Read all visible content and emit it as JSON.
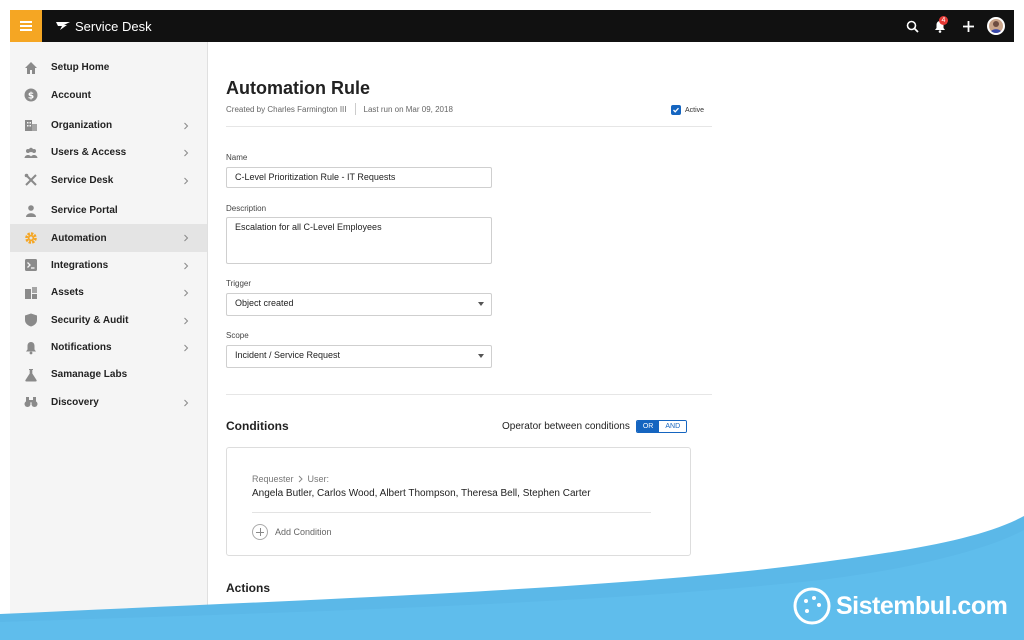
{
  "header": {
    "menu_icon": "hamburger-icon",
    "brand": "Service Desk",
    "icons": [
      "search-icon",
      "bell-icon",
      "plus-icon",
      "avatar"
    ],
    "notification_count": "4",
    "accent_color": "#f5a623"
  },
  "sidebar": {
    "items": [
      {
        "label": "Setup Home",
        "icon": "home-icon",
        "chevron": false
      },
      {
        "label": "Account",
        "icon": "dollar-icon",
        "chevron": false
      },
      {
        "label": "Organization",
        "icon": "building-icon",
        "chevron": true
      },
      {
        "label": "Users & Access",
        "icon": "users-icon",
        "chevron": true
      },
      {
        "label": "Service Desk",
        "icon": "tools-icon",
        "chevron": true
      },
      {
        "label": "Service Portal",
        "icon": "person-icon",
        "chevron": false
      },
      {
        "label": "Automation",
        "icon": "gear-icon",
        "chevron": true,
        "active": true
      },
      {
        "label": "Integrations",
        "icon": "terminal-icon",
        "chevron": true
      },
      {
        "label": "Assets",
        "icon": "assets-icon",
        "chevron": true
      },
      {
        "label": "Security & Audit",
        "icon": "shield-icon",
        "chevron": true
      },
      {
        "label": "Notifications",
        "icon": "bell-icon",
        "chevron": true
      },
      {
        "label": "Samanage Labs",
        "icon": "flask-icon",
        "chevron": false
      },
      {
        "label": "Discovery",
        "icon": "binoculars-icon",
        "chevron": true
      }
    ]
  },
  "main": {
    "title": "Automation Rule",
    "created_by": "Created by Charles Farmington III",
    "last_run": "Last run on Mar 09, 2018",
    "active_label": "Active",
    "active_checked": true,
    "name_label": "Name",
    "name_value": "C-Level Prioritization Rule - IT Requests",
    "description_label": "Description",
    "description_value": "Escalation for all C-Level Employees",
    "trigger_label": "Trigger",
    "trigger_value": "Object created",
    "scope_label": "Scope",
    "scope_value": "Incident / Service Request",
    "conditions_title": "Conditions",
    "operator_label": "Operator between conditions",
    "operator_or": "OR",
    "operator_and": "AND",
    "operator_selected": "OR",
    "condition": {
      "path_1": "Requester",
      "path_2": "User:",
      "value": "Angela Butler, Carlos Wood, Albert Thompson, Theresa Bell, Stephen Carter"
    },
    "add_condition": "Add Condition",
    "actions_title": "Actions"
  },
  "watermark": {
    "text": "Sistembul.com",
    "wave_color": "#5bb8e8"
  }
}
